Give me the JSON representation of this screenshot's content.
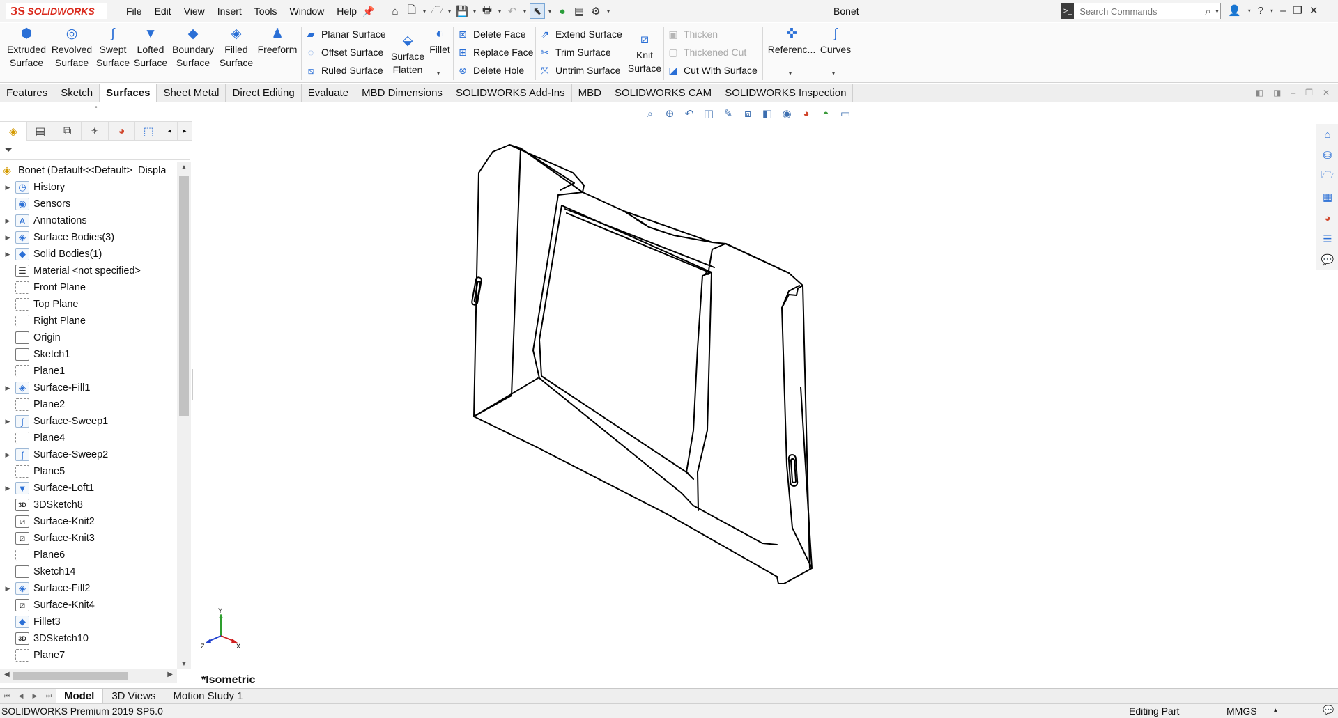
{
  "app": {
    "logo_ds": "3S",
    "logo_text": "SOLIDWORKS",
    "document_title": "Bonet"
  },
  "menu": [
    "File",
    "Edit",
    "View",
    "Insert",
    "Tools",
    "Window",
    "Help"
  ],
  "search": {
    "placeholder": "Search Commands"
  },
  "ribbon": {
    "large": [
      {
        "line1": "Extruded",
        "line2": "Surface"
      },
      {
        "line1": "Revolved",
        "line2": "Surface"
      },
      {
        "line1": "Swept",
        "line2": "Surface"
      },
      {
        "line1": "Lofted",
        "line2": "Surface"
      },
      {
        "line1": "Boundary",
        "line2": "Surface"
      },
      {
        "line1": "Filled",
        "line2": "Surface"
      },
      {
        "line1": "Freeform",
        "line2": ""
      }
    ],
    "col1": [
      "Planar Surface",
      "Offset Surface",
      "Ruled Surface"
    ],
    "flatten": {
      "line1": "Surface",
      "line2": "Flatten"
    },
    "fillet": "Fillet",
    "col2": [
      "Delete Face",
      "Replace Face",
      "Delete Hole"
    ],
    "col3": [
      "Extend Surface",
      "Trim Surface",
      "Untrim Surface"
    ],
    "knit": {
      "line1": "Knit",
      "line2": "Surface"
    },
    "col4": [
      "Thicken",
      "Thickened Cut",
      "Cut With Surface"
    ],
    "reference": "Referenc...",
    "curves": "Curves"
  },
  "cm_tabs": [
    "Features",
    "Sketch",
    "Surfaces",
    "Sheet Metal",
    "Direct Editing",
    "Evaluate",
    "MBD Dimensions",
    "SOLIDWORKS Add-Ins",
    "MBD",
    "SOLIDWORKS CAM",
    "SOLIDWORKS Inspection"
  ],
  "cm_active": "Surfaces",
  "tree": {
    "root": "Bonet  (Default<<Default>_Displa",
    "items": [
      {
        "label": "History",
        "icon": "history-icon",
        "glyph": "◷",
        "kind": "folder",
        "expand": true
      },
      {
        "label": "Sensors",
        "icon": "sensors-icon",
        "glyph": "◉",
        "kind": "folder",
        "expand": false
      },
      {
        "label": "Annotations",
        "icon": "annotations-icon",
        "glyph": "A",
        "kind": "folder",
        "expand": true
      },
      {
        "label": "Surface Bodies(3)",
        "icon": "surface-bodies-icon",
        "glyph": "◈",
        "kind": "folder",
        "expand": true
      },
      {
        "label": "Solid Bodies(1)",
        "icon": "solid-bodies-icon",
        "glyph": "◆",
        "kind": "folder",
        "expand": true
      },
      {
        "label": "Material <not specified>",
        "icon": "material-icon",
        "glyph": "☰",
        "kind": "sketch",
        "expand": false
      },
      {
        "label": "Front Plane",
        "icon": "plane-icon",
        "glyph": "",
        "kind": "plane",
        "expand": false
      },
      {
        "label": "Top Plane",
        "icon": "plane-icon",
        "glyph": "",
        "kind": "plane",
        "expand": false
      },
      {
        "label": "Right Plane",
        "icon": "plane-icon",
        "glyph": "",
        "kind": "plane",
        "expand": false
      },
      {
        "label": "Origin",
        "icon": "origin-icon",
        "glyph": "∟",
        "kind": "sketch",
        "expand": false
      },
      {
        "label": "Sketch1",
        "icon": "sketch-icon",
        "glyph": "",
        "kind": "sketch",
        "expand": false
      },
      {
        "label": "Plane1",
        "icon": "plane-icon",
        "glyph": "",
        "kind": "plane",
        "expand": false
      },
      {
        "label": "Surface-Fill1",
        "icon": "surface-fill-icon",
        "glyph": "◈",
        "kind": "feature",
        "expand": true
      },
      {
        "label": "Plane2",
        "icon": "plane-icon",
        "glyph": "",
        "kind": "plane",
        "expand": false
      },
      {
        "label": "Surface-Sweep1",
        "icon": "surface-sweep-icon",
        "glyph": "∫",
        "kind": "feature",
        "expand": true
      },
      {
        "label": "Plane4",
        "icon": "plane-icon",
        "glyph": "",
        "kind": "plane",
        "expand": false
      },
      {
        "label": "Surface-Sweep2",
        "icon": "surface-sweep-icon",
        "glyph": "∫",
        "kind": "feature",
        "expand": true
      },
      {
        "label": "Plane5",
        "icon": "plane-icon",
        "glyph": "",
        "kind": "plane",
        "expand": false
      },
      {
        "label": "Surface-Loft1",
        "icon": "surface-loft-icon",
        "glyph": "▼",
        "kind": "feature",
        "expand": true
      },
      {
        "label": "3DSketch8",
        "icon": "3dsketch-icon",
        "glyph": "3D",
        "kind": "tdsk",
        "expand": false
      },
      {
        "label": "Surface-Knit2",
        "icon": "surface-knit-icon",
        "glyph": "⧄",
        "kind": "sketch",
        "expand": false
      },
      {
        "label": "Surface-Knit3",
        "icon": "surface-knit-icon",
        "glyph": "⧄",
        "kind": "sketch",
        "expand": false
      },
      {
        "label": "Plane6",
        "icon": "plane-icon",
        "glyph": "",
        "kind": "plane",
        "expand": false
      },
      {
        "label": "Sketch14",
        "icon": "sketch-icon",
        "glyph": "",
        "kind": "sketch",
        "expand": false
      },
      {
        "label": "Surface-Fill2",
        "icon": "surface-fill-icon",
        "glyph": "◈",
        "kind": "feature",
        "expand": true
      },
      {
        "label": "Surface-Knit4",
        "icon": "surface-knit-icon",
        "glyph": "⧄",
        "kind": "sketch",
        "expand": false
      },
      {
        "label": "Fillet3",
        "icon": "fillet-icon",
        "glyph": "◆",
        "kind": "feature",
        "expand": false
      },
      {
        "label": "3DSketch10",
        "icon": "3dsketch-icon",
        "glyph": "3D",
        "kind": "tdsk",
        "expand": false
      },
      {
        "label": "Plane7",
        "icon": "plane-icon",
        "glyph": "",
        "kind": "plane",
        "expand": false
      }
    ]
  },
  "viewport": {
    "view_label": "*Isometric",
    "triad": {
      "x": "X",
      "y": "Y",
      "z": "Z"
    }
  },
  "bottom_tabs": [
    "Model",
    "3D Views",
    "Motion Study 1"
  ],
  "bottom_active": "Model",
  "status": {
    "product": "SOLIDWORKS Premium 2019 SP5.0",
    "mode": "Editing Part",
    "units": "MMGS"
  },
  "colors": {
    "accent": "#2a6fd6",
    "brand": "#da291c"
  }
}
